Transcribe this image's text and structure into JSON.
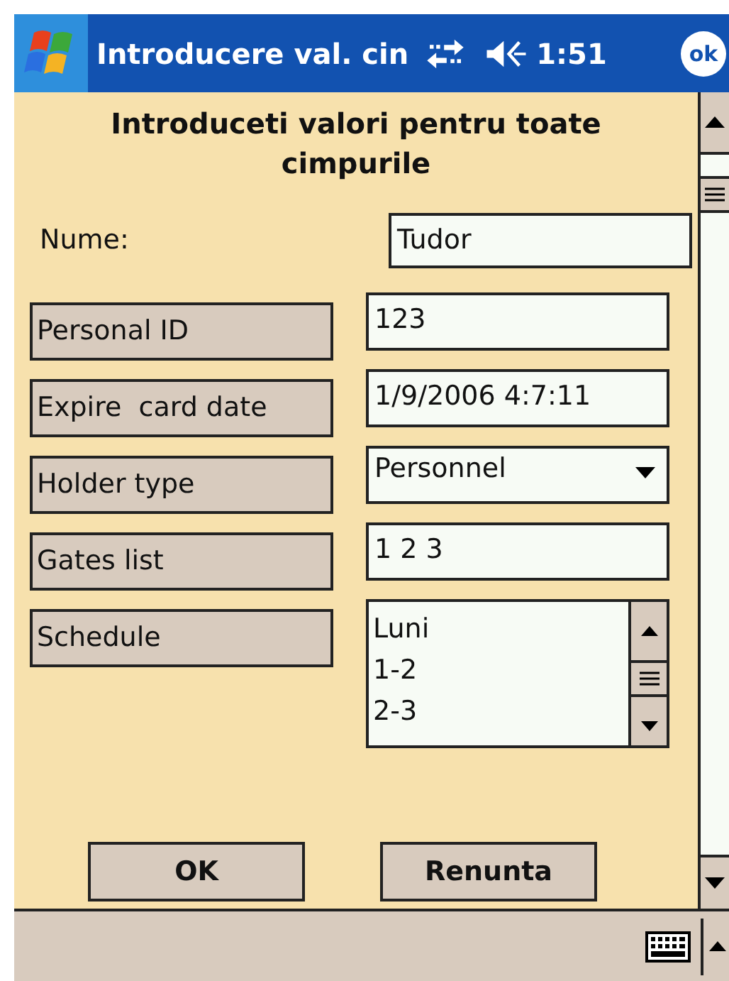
{
  "title_bar": {
    "title": "Introducere val. cin",
    "time": "1:51",
    "ok_label": "ok"
  },
  "heading": "Introduceti valori pentru toate cimpurile",
  "fields": [
    {
      "kind": "text",
      "boxed_label": false,
      "label": "Nume:",
      "value": "Tudor"
    },
    {
      "kind": "text",
      "boxed_label": true,
      "label": "Personal ID",
      "value": "123"
    },
    {
      "kind": "text",
      "boxed_label": true,
      "label": "Expire  card date",
      "value": "1/9/2006 4:7:11"
    },
    {
      "kind": "dropdown",
      "boxed_label": true,
      "label": "Holder type",
      "value": "Personnel"
    },
    {
      "kind": "text",
      "boxed_label": true,
      "label": "Gates list",
      "value": "1 2 3"
    },
    {
      "kind": "list",
      "boxed_label": true,
      "label": "Schedule",
      "lines": [
        "Luni",
        "1-2",
        "2-3"
      ]
    }
  ],
  "buttons": [
    "OK",
    "Renunta"
  ]
}
